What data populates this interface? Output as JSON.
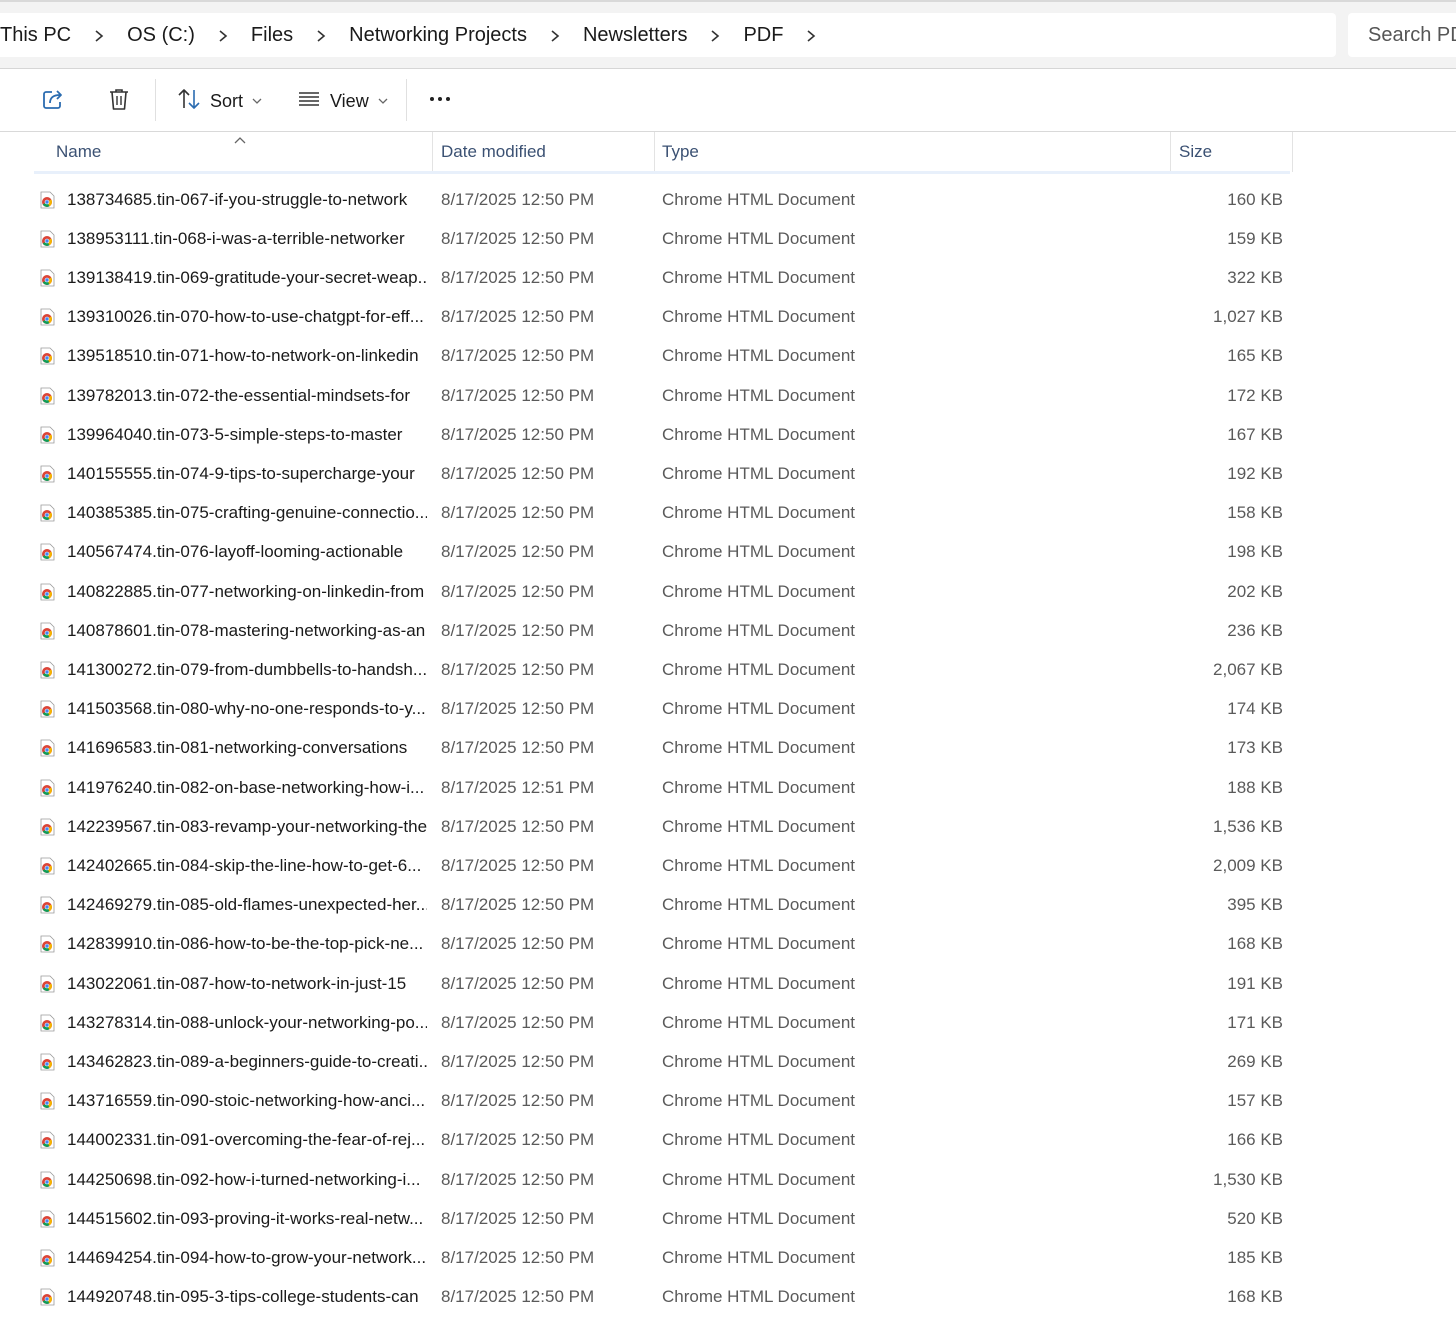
{
  "breadcrumb": [
    "This PC",
    "OS (C:)",
    "Files",
    "Networking Projects",
    "Newsletters",
    "PDF"
  ],
  "search": {
    "placeholder": "Search PDF"
  },
  "toolbar": {
    "share_icon": "share-icon",
    "delete_icon": "trash-icon",
    "sort_label": "Sort",
    "view_label": "View",
    "more_icon": "more-icon"
  },
  "columns": {
    "name": "Name",
    "date": "Date modified",
    "type": "Type",
    "size": "Size"
  },
  "colors": {
    "header_text": "#3b5173",
    "secondary_text": "#5a5a5a",
    "header_underline": "#e8f0fb"
  },
  "files": [
    {
      "name": "138734685.tin-067-if-you-struggle-to-network",
      "date": "8/17/2025 12:50 PM",
      "type": "Chrome HTML Document",
      "size": "160 KB"
    },
    {
      "name": "138953111.tin-068-i-was-a-terrible-networker",
      "date": "8/17/2025 12:50 PM",
      "type": "Chrome HTML Document",
      "size": "159 KB"
    },
    {
      "name": "139138419.tin-069-gratitude-your-secret-weap...",
      "date": "8/17/2025 12:50 PM",
      "type": "Chrome HTML Document",
      "size": "322 KB"
    },
    {
      "name": "139310026.tin-070-how-to-use-chatgpt-for-eff...",
      "date": "8/17/2025 12:50 PM",
      "type": "Chrome HTML Document",
      "size": "1,027 KB"
    },
    {
      "name": "139518510.tin-071-how-to-network-on-linkedin",
      "date": "8/17/2025 12:50 PM",
      "type": "Chrome HTML Document",
      "size": "165 KB"
    },
    {
      "name": "139782013.tin-072-the-essential-mindsets-for",
      "date": "8/17/2025 12:50 PM",
      "type": "Chrome HTML Document",
      "size": "172 KB"
    },
    {
      "name": "139964040.tin-073-5-simple-steps-to-master",
      "date": "8/17/2025 12:50 PM",
      "type": "Chrome HTML Document",
      "size": "167 KB"
    },
    {
      "name": "140155555.tin-074-9-tips-to-supercharge-your",
      "date": "8/17/2025 12:50 PM",
      "type": "Chrome HTML Document",
      "size": "192 KB"
    },
    {
      "name": "140385385.tin-075-crafting-genuine-connectio...",
      "date": "8/17/2025 12:50 PM",
      "type": "Chrome HTML Document",
      "size": "158 KB"
    },
    {
      "name": "140567474.tin-076-layoff-looming-actionable",
      "date": "8/17/2025 12:50 PM",
      "type": "Chrome HTML Document",
      "size": "198 KB"
    },
    {
      "name": "140822885.tin-077-networking-on-linkedin-from",
      "date": "8/17/2025 12:50 PM",
      "type": "Chrome HTML Document",
      "size": "202 KB"
    },
    {
      "name": "140878601.tin-078-mastering-networking-as-an",
      "date": "8/17/2025 12:50 PM",
      "type": "Chrome HTML Document",
      "size": "236 KB"
    },
    {
      "name": "141300272.tin-079-from-dumbbells-to-handsh...",
      "date": "8/17/2025 12:50 PM",
      "type": "Chrome HTML Document",
      "size": "2,067 KB"
    },
    {
      "name": "141503568.tin-080-why-no-one-responds-to-y...",
      "date": "8/17/2025 12:50 PM",
      "type": "Chrome HTML Document",
      "size": "174 KB"
    },
    {
      "name": "141696583.tin-081-networking-conversations",
      "date": "8/17/2025 12:50 PM",
      "type": "Chrome HTML Document",
      "size": "173 KB"
    },
    {
      "name": "141976240.tin-082-on-base-networking-how-i...",
      "date": "8/17/2025 12:51 PM",
      "type": "Chrome HTML Document",
      "size": "188 KB"
    },
    {
      "name": "142239567.tin-083-revamp-your-networking-the",
      "date": "8/17/2025 12:50 PM",
      "type": "Chrome HTML Document",
      "size": "1,536 KB"
    },
    {
      "name": "142402665.tin-084-skip-the-line-how-to-get-6...",
      "date": "8/17/2025 12:50 PM",
      "type": "Chrome HTML Document",
      "size": "2,009 KB"
    },
    {
      "name": "142469279.tin-085-old-flames-unexpected-her...",
      "date": "8/17/2025 12:50 PM",
      "type": "Chrome HTML Document",
      "size": "395 KB"
    },
    {
      "name": "142839910.tin-086-how-to-be-the-top-pick-ne...",
      "date": "8/17/2025 12:50 PM",
      "type": "Chrome HTML Document",
      "size": "168 KB"
    },
    {
      "name": "143022061.tin-087-how-to-network-in-just-15",
      "date": "8/17/2025 12:50 PM",
      "type": "Chrome HTML Document",
      "size": "191 KB"
    },
    {
      "name": "143278314.tin-088-unlock-your-networking-po...",
      "date": "8/17/2025 12:50 PM",
      "type": "Chrome HTML Document",
      "size": "171 KB"
    },
    {
      "name": "143462823.tin-089-a-beginners-guide-to-creati...",
      "date": "8/17/2025 12:50 PM",
      "type": "Chrome HTML Document",
      "size": "269 KB"
    },
    {
      "name": "143716559.tin-090-stoic-networking-how-anci...",
      "date": "8/17/2025 12:50 PM",
      "type": "Chrome HTML Document",
      "size": "157 KB"
    },
    {
      "name": "144002331.tin-091-overcoming-the-fear-of-rej...",
      "date": "8/17/2025 12:50 PM",
      "type": "Chrome HTML Document",
      "size": "166 KB"
    },
    {
      "name": "144250698.tin-092-how-i-turned-networking-i...",
      "date": "8/17/2025 12:50 PM",
      "type": "Chrome HTML Document",
      "size": "1,530 KB"
    },
    {
      "name": "144515602.tin-093-proving-it-works-real-netw...",
      "date": "8/17/2025 12:50 PM",
      "type": "Chrome HTML Document",
      "size": "520 KB"
    },
    {
      "name": "144694254.tin-094-how-to-grow-your-network...",
      "date": "8/17/2025 12:50 PM",
      "type": "Chrome HTML Document",
      "size": "185 KB"
    },
    {
      "name": "144920748.tin-095-3-tips-college-students-can",
      "date": "8/17/2025 12:50 PM",
      "type": "Chrome HTML Document",
      "size": "168 KB"
    }
  ]
}
